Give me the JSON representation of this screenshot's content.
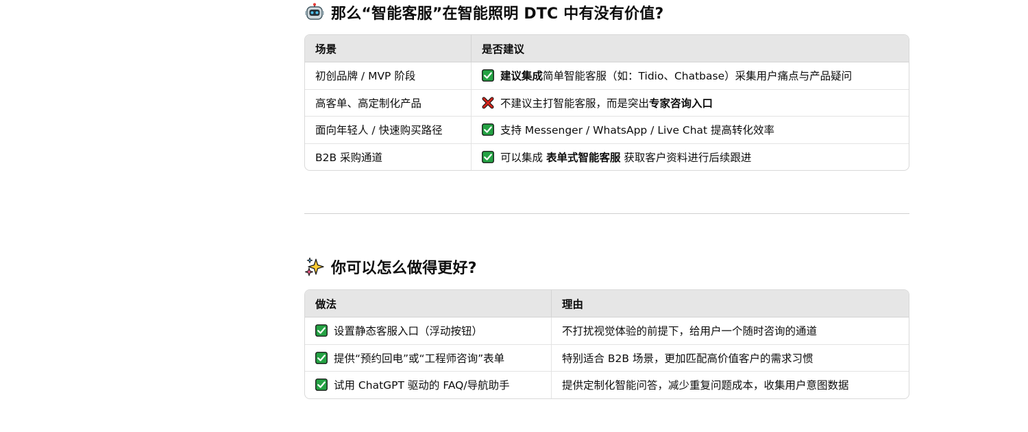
{
  "section1": {
    "icon": "robot-icon",
    "title": "那么“智能客服”在智能照明 DTC 中有没有价值?",
    "headers": [
      "场景",
      "是否建议"
    ],
    "rows": [
      {
        "scenario": "初创品牌 / MVP 阶段",
        "mark": "check-icon",
        "parts": [
          {
            "text": "建议集成",
            "bold": true
          },
          {
            "text": "简单智能客服（如：Tidio、Chatbase）采集用户痛点与产品疑问",
            "bold": false
          }
        ]
      },
      {
        "scenario": "高客单、高定制化产品",
        "mark": "cross-icon",
        "parts": [
          {
            "text": "不建议主打智能客服，而是突出",
            "bold": false
          },
          {
            "text": "专家咨询入口",
            "bold": true
          }
        ]
      },
      {
        "scenario": "面向年轻人 / 快速购买路径",
        "mark": "check-icon",
        "parts": [
          {
            "text": "支持 Messenger / WhatsApp / Live Chat 提高转化效率",
            "bold": false
          }
        ]
      },
      {
        "scenario": "B2B 采购通道",
        "mark": "check-icon",
        "parts": [
          {
            "text": "可以集成 ",
            "bold": false
          },
          {
            "text": "表单式智能客服",
            "bold": true
          },
          {
            "text": " 获取客户资料进行后续跟进",
            "bold": false
          }
        ]
      }
    ]
  },
  "section2": {
    "icon": "sparkles-icon",
    "title": "你可以怎么做得更好?",
    "headers": [
      "做法",
      "理由"
    ],
    "rows": [
      {
        "mark": "check-icon",
        "practice": "设置静态客服入口（浮动按钮）",
        "reason": "不打扰视觉体验的前提下，给用户一个随时咨询的通道"
      },
      {
        "mark": "check-icon",
        "practice": "提供“预约回电”或“工程师咨询”表单",
        "reason": "特别适合 B2B 场景，更加匹配高价值客户的需求习惯"
      },
      {
        "mark": "check-icon",
        "practice": "试用 ChatGPT 驱动的 FAQ/导航助手",
        "reason": "提供定制化智能问答，减少重复问题成本，收集用户意图数据"
      }
    ]
  },
  "colors": {
    "check_green": "#25a244",
    "cross_red": "#d0261d",
    "header_bg": "#e6e6e6",
    "border": "#d9d9d9"
  }
}
